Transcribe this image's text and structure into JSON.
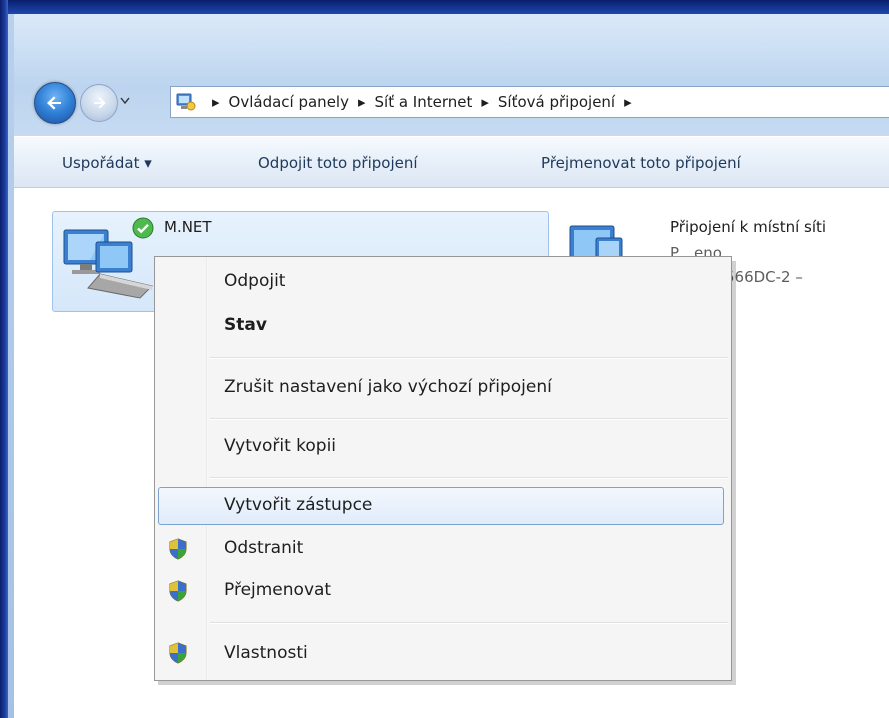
{
  "address_bar": {
    "crumbs": [
      "Ovládací panely",
      "Síť a Internet",
      "Síťová připojení"
    ]
  },
  "toolbar": {
    "organize": "Uspořádat ▾",
    "disconnect": "Odpojit toto připojení",
    "rename": "Přejmenovat toto připojení"
  },
  "items": [
    {
      "title": "M.NET",
      "subtitle": "",
      "selected": true,
      "status": "connected"
    },
    {
      "title": "Připojení k místní síti",
      "subtitle_1": "P…eno",
      "subtitle_2": "…X) 82566DC-2 –"
    }
  ],
  "context_menu": {
    "items": [
      {
        "label": "Odpojit",
        "bold": false,
        "shield": false
      },
      {
        "label": "Stav",
        "bold": true,
        "shield": false
      },
      {
        "label": "Zrušit nastavení jako výchozí připojení",
        "bold": false,
        "shield": false
      },
      {
        "label": "Vytvořit kopii",
        "bold": false,
        "shield": false
      },
      {
        "label": "Vytvořit zástupce",
        "bold": false,
        "shield": false,
        "hovered": true
      },
      {
        "label": "Odstranit",
        "bold": false,
        "shield": true
      },
      {
        "label": "Přejmenovat",
        "bold": false,
        "shield": true
      },
      {
        "label": "Vlastnosti",
        "bold": false,
        "shield": true
      }
    ]
  },
  "colors": {
    "frame_blue": "#1e48b0",
    "toolbar_text": "#1e395b",
    "hover_border": "#7da2ce",
    "shield_green": "#3aa33a"
  }
}
